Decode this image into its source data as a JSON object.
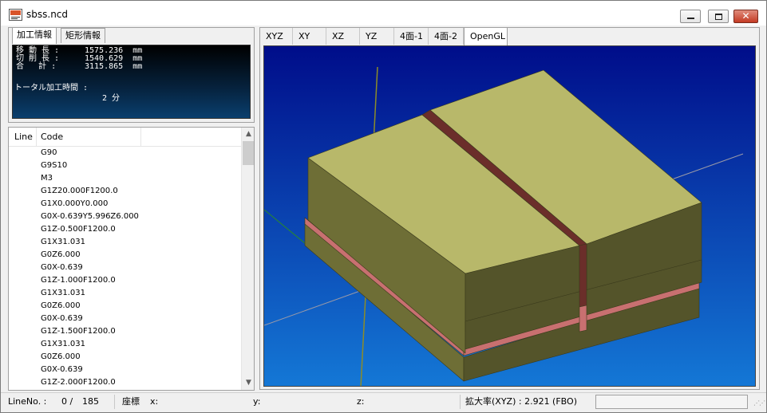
{
  "window": {
    "title": "sbss.ncd"
  },
  "info_panel": {
    "tabs": [
      "加工情報",
      "矩形情報"
    ],
    "active_tab": 0,
    "move_length_label": "移 動 長 :",
    "move_length_value": "1575.236  mm",
    "cut_length_label": "切 削 長 :",
    "cut_length_value": "1540.629  mm",
    "total_label": "合   計 :",
    "total_value": "3115.865  mm",
    "total_time_label": "トータル加工時間 :",
    "total_time_value": "2 分"
  },
  "code_list": {
    "columns": [
      "Line",
      "Code"
    ],
    "rows": [
      "G90",
      "G9S10",
      "M3",
      "G1Z20.000F1200.0",
      "G1X0.000Y0.000",
      "G0X-0.639Y5.996Z6.000",
      "G1Z-0.500F1200.0",
      "G1X31.031",
      "G0Z6.000",
      "G0X-0.639",
      "G1Z-1.000F1200.0",
      "G1X31.031",
      "G0Z6.000",
      "G0X-0.639",
      "G1Z-1.500F1200.0",
      "G1X31.031",
      "G0Z6.000",
      "G0X-0.639",
      "G1Z-2.000F1200.0"
    ],
    "scroll_up": "▲",
    "scroll_down": "▼"
  },
  "view_tabs": [
    "XYZ",
    "XY",
    "XZ",
    "YZ",
    "4面-1",
    "4面-2",
    "OpenGL"
  ],
  "active_view_tab": 6,
  "model_colors": {
    "background_top": "#000d8a",
    "background_bottom": "#1478d6",
    "top_face": "#b8b86a",
    "side_left": "#6e6e36",
    "side_front": "#54542a",
    "groove": "#6b2e2a",
    "layer_stripe": "#c87070"
  },
  "status_bar": {
    "line_no_label": "LineNo. :",
    "line_no_value": "0 /",
    "line_total": "185",
    "coord_label": "座標",
    "x_label": "x:",
    "y_label": "y:",
    "z_label": "z:",
    "zoom_label": "拡大率(XYZ) : 2.921 (FBO)"
  }
}
